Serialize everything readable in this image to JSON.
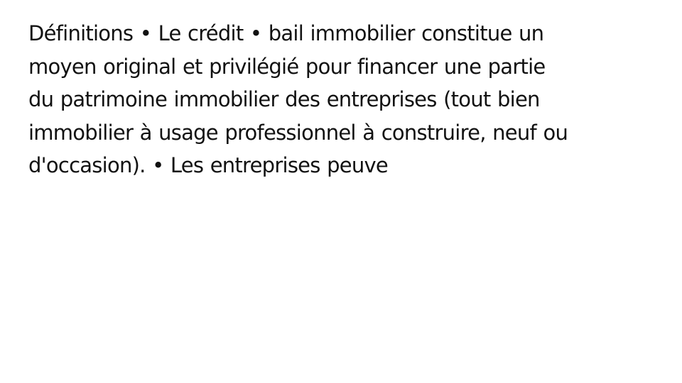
{
  "slide": {
    "lines": [
      "Définitions • Le crédit • bail immobilier constitue un",
      "moyen original et privilégié pour financer une partie",
      "du patrimoine immobilier des entreprises (tout bien",
      "immobilier à usage professionnel à construire, neuf ou",
      "d'occasion). • Les entreprises peuve"
    ]
  },
  "colors": {
    "background": "#ffffff",
    "text": "#111111"
  }
}
